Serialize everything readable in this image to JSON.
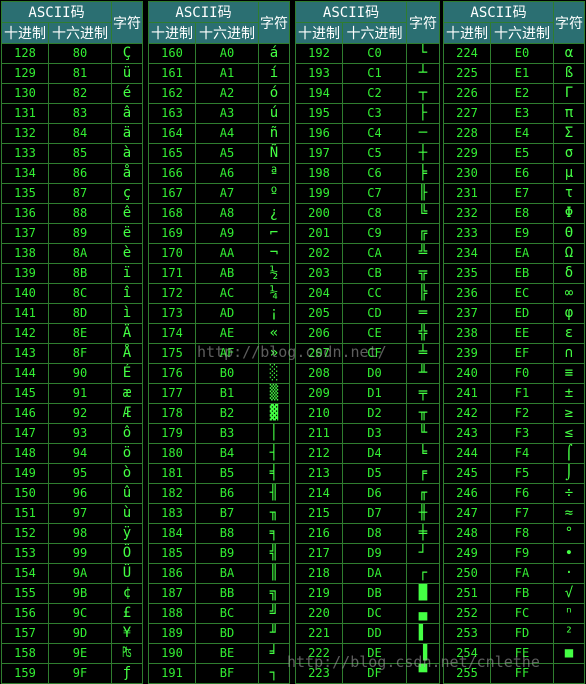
{
  "header": {
    "group_label": "ASCII码",
    "dec_label": "十进制",
    "hex_label": "十六进制",
    "char_label": "字符"
  },
  "watermarks": [
    "http://blog.csdn.net/",
    "http://blog.csdn.net/cnlethe"
  ],
  "tables": [
    {
      "rows": [
        [
          "128",
          "80",
          "Ç"
        ],
        [
          "129",
          "81",
          "ü"
        ],
        [
          "130",
          "82",
          "é"
        ],
        [
          "131",
          "83",
          "â"
        ],
        [
          "132",
          "84",
          "ä"
        ],
        [
          "133",
          "85",
          "à"
        ],
        [
          "134",
          "86",
          "å"
        ],
        [
          "135",
          "87",
          "ç"
        ],
        [
          "136",
          "88",
          "ê"
        ],
        [
          "137",
          "89",
          "ë"
        ],
        [
          "138",
          "8A",
          "è"
        ],
        [
          "139",
          "8B",
          "ï"
        ],
        [
          "140",
          "8C",
          "î"
        ],
        [
          "141",
          "8D",
          "ì"
        ],
        [
          "142",
          "8E",
          "Ä"
        ],
        [
          "143",
          "8F",
          "Å"
        ],
        [
          "144",
          "90",
          "É"
        ],
        [
          "145",
          "91",
          "æ"
        ],
        [
          "146",
          "92",
          "Æ"
        ],
        [
          "147",
          "93",
          "ô"
        ],
        [
          "148",
          "94",
          "ö"
        ],
        [
          "149",
          "95",
          "ò"
        ],
        [
          "150",
          "96",
          "û"
        ],
        [
          "151",
          "97",
          "ù"
        ],
        [
          "152",
          "98",
          "ÿ"
        ],
        [
          "153",
          "99",
          "Ö"
        ],
        [
          "154",
          "9A",
          "Ü"
        ],
        [
          "155",
          "9B",
          "¢"
        ],
        [
          "156",
          "9C",
          "£"
        ],
        [
          "157",
          "9D",
          "¥"
        ],
        [
          "158",
          "9E",
          "₧"
        ],
        [
          "159",
          "9F",
          "ƒ"
        ]
      ]
    },
    {
      "rows": [
        [
          "160",
          "A0",
          "á"
        ],
        [
          "161",
          "A1",
          "í"
        ],
        [
          "162",
          "A2",
          "ó"
        ],
        [
          "163",
          "A3",
          "ú"
        ],
        [
          "164",
          "A4",
          "ñ"
        ],
        [
          "165",
          "A5",
          "Ñ"
        ],
        [
          "166",
          "A6",
          "ª"
        ],
        [
          "167",
          "A7",
          "º"
        ],
        [
          "168",
          "A8",
          "¿"
        ],
        [
          "169",
          "A9",
          "⌐"
        ],
        [
          "170",
          "AA",
          "¬"
        ],
        [
          "171",
          "AB",
          "½"
        ],
        [
          "172",
          "AC",
          "¼"
        ],
        [
          "173",
          "AD",
          "¡"
        ],
        [
          "174",
          "AE",
          "«"
        ],
        [
          "175",
          "AF",
          "»"
        ],
        [
          "176",
          "B0",
          "░"
        ],
        [
          "177",
          "B1",
          "▒"
        ],
        [
          "178",
          "B2",
          "▓"
        ],
        [
          "179",
          "B3",
          "│"
        ],
        [
          "180",
          "B4",
          "┤"
        ],
        [
          "181",
          "B5",
          "╡"
        ],
        [
          "182",
          "B6",
          "╢"
        ],
        [
          "183",
          "B7",
          "╖"
        ],
        [
          "184",
          "B8",
          "╕"
        ],
        [
          "185",
          "B9",
          "╣"
        ],
        [
          "186",
          "BA",
          "║"
        ],
        [
          "187",
          "BB",
          "╗"
        ],
        [
          "188",
          "BC",
          "╝"
        ],
        [
          "189",
          "BD",
          "╜"
        ],
        [
          "190",
          "BE",
          "╛"
        ],
        [
          "191",
          "BF",
          "┐"
        ]
      ]
    },
    {
      "rows": [
        [
          "192",
          "C0",
          "└"
        ],
        [
          "193",
          "C1",
          "┴"
        ],
        [
          "194",
          "C2",
          "┬"
        ],
        [
          "195",
          "C3",
          "├"
        ],
        [
          "196",
          "C4",
          "─"
        ],
        [
          "197",
          "C5",
          "┼"
        ],
        [
          "198",
          "C6",
          "╞"
        ],
        [
          "199",
          "C7",
          "╟"
        ],
        [
          "200",
          "C8",
          "╚"
        ],
        [
          "201",
          "C9",
          "╔"
        ],
        [
          "202",
          "CA",
          "╩"
        ],
        [
          "203",
          "CB",
          "╦"
        ],
        [
          "204",
          "CC",
          "╠"
        ],
        [
          "205",
          "CD",
          "═"
        ],
        [
          "206",
          "CE",
          "╬"
        ],
        [
          "207",
          "CF",
          "╧"
        ],
        [
          "208",
          "D0",
          "╨"
        ],
        [
          "209",
          "D1",
          "╤"
        ],
        [
          "210",
          "D2",
          "╥"
        ],
        [
          "211",
          "D3",
          "╙"
        ],
        [
          "212",
          "D4",
          "╘"
        ],
        [
          "213",
          "D5",
          "╒"
        ],
        [
          "214",
          "D6",
          "╓"
        ],
        [
          "215",
          "D7",
          "╫"
        ],
        [
          "216",
          "D8",
          "╪"
        ],
        [
          "217",
          "D9",
          "┘"
        ],
        [
          "218",
          "DA",
          "┌"
        ],
        [
          "219",
          "DB",
          "█"
        ],
        [
          "220",
          "DC",
          "▄"
        ],
        [
          "221",
          "DD",
          "▌"
        ],
        [
          "222",
          "DE",
          "▐"
        ],
        [
          "223",
          "DF",
          "▀"
        ]
      ]
    },
    {
      "rows": [
        [
          "224",
          "E0",
          "α"
        ],
        [
          "225",
          "E1",
          "ß"
        ],
        [
          "226",
          "E2",
          "Γ"
        ],
        [
          "227",
          "E3",
          "π"
        ],
        [
          "228",
          "E4",
          "Σ"
        ],
        [
          "229",
          "E5",
          "σ"
        ],
        [
          "230",
          "E6",
          "µ"
        ],
        [
          "231",
          "E7",
          "τ"
        ],
        [
          "232",
          "E8",
          "Φ"
        ],
        [
          "233",
          "E9",
          "Θ"
        ],
        [
          "234",
          "EA",
          "Ω"
        ],
        [
          "235",
          "EB",
          "δ"
        ],
        [
          "236",
          "EC",
          "∞"
        ],
        [
          "237",
          "ED",
          "φ"
        ],
        [
          "238",
          "EE",
          "ε"
        ],
        [
          "239",
          "EF",
          "∩"
        ],
        [
          "240",
          "F0",
          "≡"
        ],
        [
          "241",
          "F1",
          "±"
        ],
        [
          "242",
          "F2",
          "≥"
        ],
        [
          "243",
          "F3",
          "≤"
        ],
        [
          "244",
          "F4",
          "⌠"
        ],
        [
          "245",
          "F5",
          "⌡"
        ],
        [
          "246",
          "F6",
          "÷"
        ],
        [
          "247",
          "F7",
          "≈"
        ],
        [
          "248",
          "F8",
          "°"
        ],
        [
          "249",
          "F9",
          "∙"
        ],
        [
          "250",
          "FA",
          "·"
        ],
        [
          "251",
          "FB",
          "√"
        ],
        [
          "252",
          "FC",
          "ⁿ"
        ],
        [
          "253",
          "FD",
          "²"
        ],
        [
          "254",
          "FE",
          "■"
        ],
        [
          "255",
          "FF",
          " "
        ]
      ]
    }
  ]
}
